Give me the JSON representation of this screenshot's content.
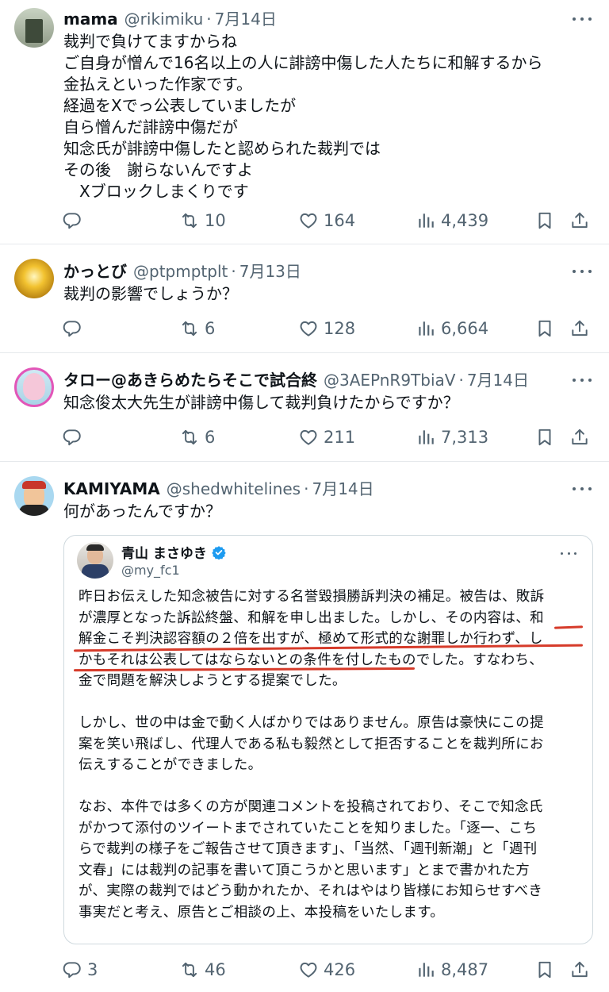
{
  "posts": [
    {
      "name": "mama",
      "handle": "@rikimiku",
      "date": "7月14日",
      "lines": [
        "裁判で負けてますからね",
        "ご自身が憎んで16名以上の人に誹謗中傷した人たちに和解するから",
        "金払えといった作家です。",
        "経過をXでっ公表していましたが",
        "自ら憎んだ誹謗中傷だが",
        "知念氏が誹謗中傷したと認められた裁判では",
        "その後　謝らないんですよ",
        "　Xブロックしまくりです"
      ],
      "replies": "",
      "reposts": "10",
      "likes": "164",
      "views": "4,439"
    },
    {
      "name": "かっとび",
      "handle": "@ptpmptplt",
      "date": "7月13日",
      "lines": [
        "裁判の影響でしょうか？"
      ],
      "replies": "",
      "reposts": "6",
      "likes": "128",
      "views": "6,664"
    },
    {
      "name": "タロー@あきらめたらそこで試合終",
      "handle": "@3AEPnR9TbiaV",
      "date": "7月14日",
      "lines": [
        "知念俊太大先生が誹謗中傷して裁判負けたからですか？"
      ],
      "replies": "",
      "reposts": "6",
      "likes": "211",
      "views": "7,313"
    },
    {
      "name": "KAMIYAMA",
      "handle": "@shedwhitelines",
      "date": "7月14日",
      "lines": [
        "何があったんですか？"
      ],
      "replies": "3",
      "reposts": "46",
      "likes": "426",
      "views": "8,487"
    }
  ],
  "quote": {
    "name": "青山 まさゆき",
    "handle": "@my_fc1",
    "lines": [
      "昨日お伝えした知念被告に対する名誉毀損勝訴判決の補足。被告は、敗訴",
      "が濃厚となった訴訟終盤、和解を申し出ました。しかし、その内容は、和",
      "解金こそ判決認容額の２倍を出すが、極めて形式的な謝罪しか行わず、し",
      "かもそれは公表してはならないとの条件を付したものでした。すなわち、",
      "金で問題を解決しようとする提案でした。",
      "",
      "しかし、世の中は金で動く人ばかりではありません。原告は豪快にこの提",
      "案を笑い飛ばし、代理人である私も毅然として拒否することを裁判所にお",
      "伝えすることができました。",
      "",
      "なお、本件では多くの方が関連コメントを投稿されており、そこで知念氏",
      "がかつて添付のツイートまでされていたことを知りました。「逐一、こち",
      "らで裁判の様子をご報告させて頂きます」、「当然、「週刊新潮」と「週刊",
      "文春」には裁判の記事を書いて頂こうかと思います」とまで書かれた方",
      "が、実際の裁判ではどう動かれたか、それはやはり皆様にお知らせすべき",
      "事実だと考え、原告とご相談の上、本投稿をいたします。"
    ]
  },
  "icons": {
    "reply": "reply-icon",
    "repost": "repost-icon",
    "like": "heart-icon",
    "views": "views-icon",
    "bookmark": "bookmark-icon",
    "share": "share-icon",
    "verified": "verified-badge-icon",
    "more": "more-icon"
  },
  "colors": {
    "text": "#0f1419",
    "secondary": "#536471",
    "border": "#e6e9ec",
    "verified": "#1d9bf0",
    "underline": "#d63b2a"
  }
}
